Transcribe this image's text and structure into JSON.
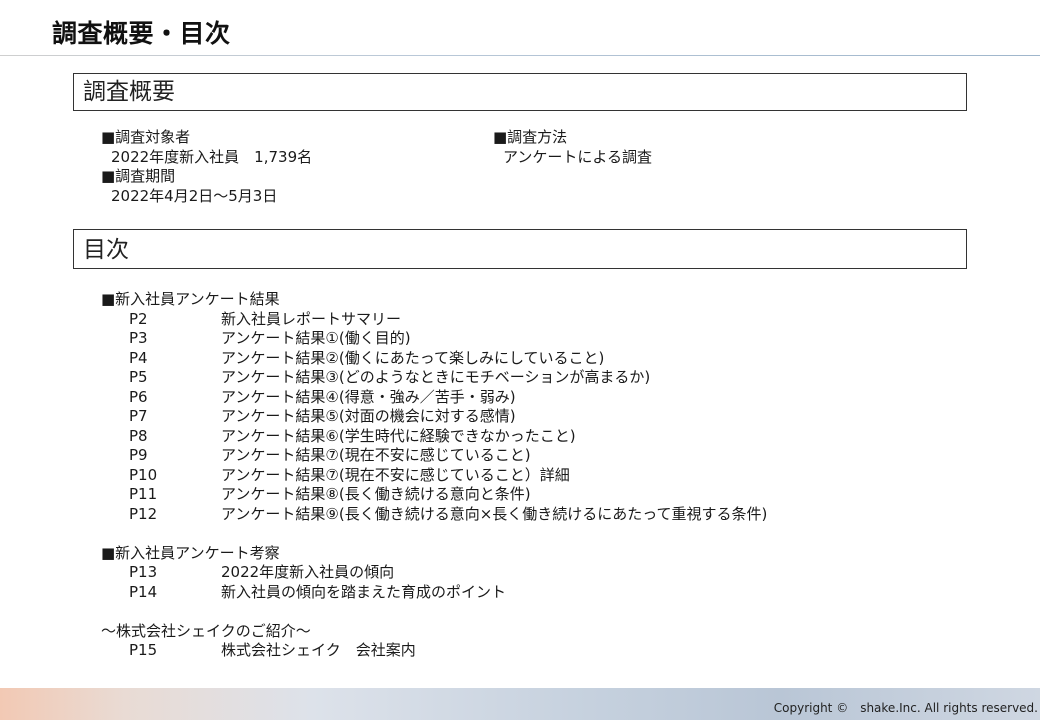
{
  "page_title": "調査概要・目次",
  "overview": {
    "heading": "調査概要",
    "target_label": "■調査対象者",
    "target_value": "2022年度新入社員　1,739名",
    "period_label": "■調査期間",
    "period_value": "2022年4月2日～5月3日",
    "method_label": "■調査方法",
    "method_value": "アンケートによる調査"
  },
  "toc": {
    "heading": "目次",
    "sections": [
      {
        "title": "■新入社員アンケート結果",
        "items": [
          {
            "page": "P2",
            "label": "新入社員レポートサマリー"
          },
          {
            "page": "P3",
            "label": "アンケート結果①(働く目的)"
          },
          {
            "page": "P4",
            "label": "アンケート結果②(働くにあたって楽しみにしていること)"
          },
          {
            "page": "P5",
            "label": "アンケート結果③(どのようなときにモチベーションが高まるか)"
          },
          {
            "page": "P6",
            "label": "アンケート結果④(得意・強み／苦手・弱み)"
          },
          {
            "page": "P7",
            "label": "アンケート結果⑤(対面の機会に対する感情)"
          },
          {
            "page": "P8",
            "label": "アンケート結果⑥(学生時代に経験できなかったこと)"
          },
          {
            "page": "P9",
            "label": "アンケート結果⑦(現在不安に感じていること)"
          },
          {
            "page": "P10",
            "label": "アンケート結果⑦(現在不安に感じていること）詳細"
          },
          {
            "page": "P11",
            "label": "アンケート結果⑧(長く働き続ける意向と条件)"
          },
          {
            "page": "P12",
            "label": "アンケート結果⑨(長く働き続ける意向×長く働き続けるにあたって重視する条件)"
          }
        ]
      },
      {
        "title": "■新入社員アンケート考察",
        "items": [
          {
            "page": "P13",
            "label": "2022年度新入社員の傾向"
          },
          {
            "page": "P14",
            "label": "新入社員の傾向を踏まえた育成のポイント"
          }
        ]
      },
      {
        "title": "～株式会社シェイクのご紹介～",
        "items": [
          {
            "page": "P15",
            "label": "株式会社シェイク　会社案内"
          }
        ]
      }
    ]
  },
  "footer": {
    "copyright": "Copyright ©　shake.Inc.  All rights reserved."
  }
}
